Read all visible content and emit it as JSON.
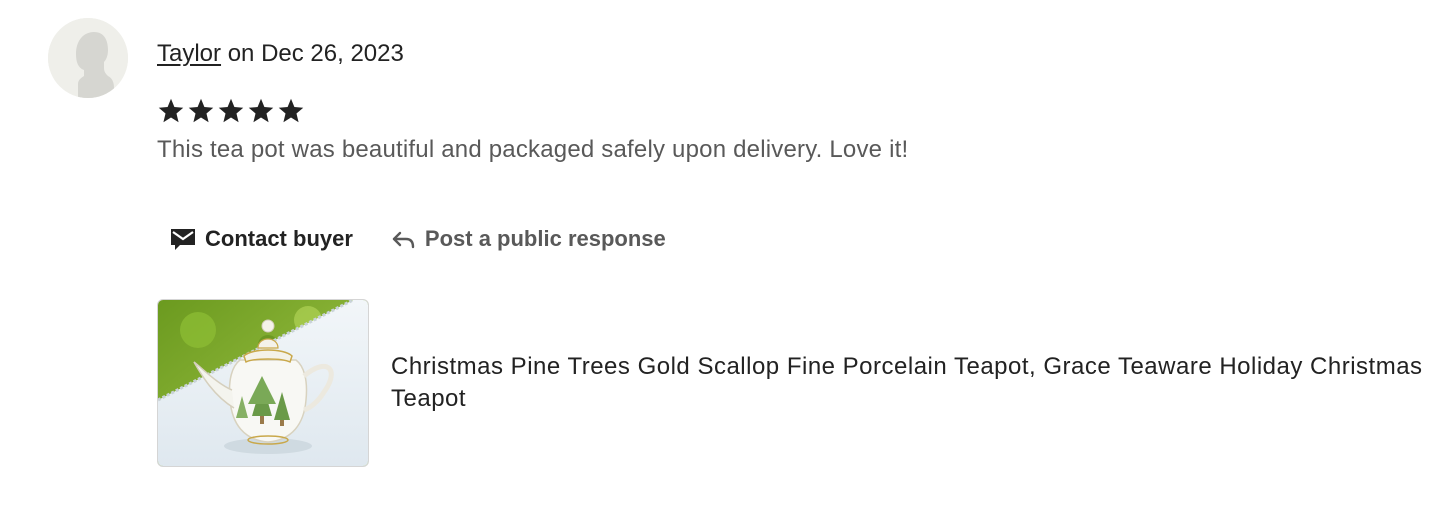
{
  "review": {
    "reviewer_name": "Taylor",
    "date_prefix": " on ",
    "date": "Dec 26, 2023",
    "rating": 5,
    "max_rating": 5,
    "text": "This tea pot was beautiful and packaged safely upon delivery. Love it!"
  },
  "actions": {
    "contact_label": "Contact buyer",
    "contact_icon": "envelope-icon",
    "response_label": "Post a public response",
    "response_icon": "reply-arrow-icon"
  },
  "listing": {
    "title": "Christmas Pine Trees Gold Scallop Fine Porcelain Teapot, Grace Teaware Holiday Christmas Teapot"
  },
  "colors": {
    "text_primary": "#222222",
    "text_secondary": "#595959",
    "avatar_bg": "#efefea",
    "star": "#222222"
  }
}
